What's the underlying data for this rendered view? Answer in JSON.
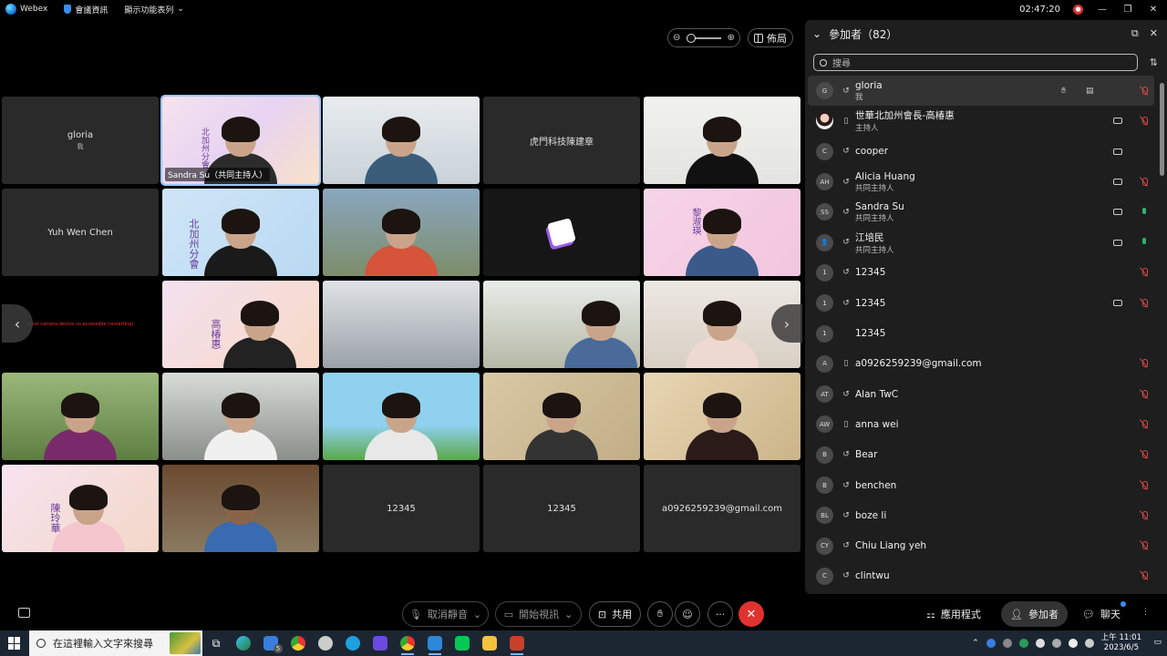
{
  "titlebar": {
    "app_name": "Webex",
    "meeting_info": "會議資訊",
    "menu": "顯示功能表列",
    "time": "02:47:20",
    "win_min": "—",
    "win_restore": "❐",
    "win_close": "✕"
  },
  "top_controls": {
    "zoom_out": "⊖",
    "zoom_in": "⊕",
    "layout_label": "佈局"
  },
  "tiles": [
    {
      "name": "gloria",
      "sub": "我"
    },
    {
      "label": "Sandra Su（共同主持人）",
      "banner": "北加州分會"
    },
    {},
    {
      "name": "虎門科技陳建章"
    },
    {},
    {
      "name": "Yuh Wen Chen"
    },
    {
      "banner": "北加州分會"
    },
    {},
    {},
    {
      "banner": "黎淑瑛"
    },
    {
      "red": "Input camera device no accessible (restarting)"
    },
    {
      "banner": "高椿惠"
    },
    {},
    {},
    {},
    {},
    {},
    {},
    {},
    {},
    {
      "banner": "陳玲華"
    },
    {},
    {
      "name": "12345"
    },
    {
      "name": "12345"
    },
    {
      "name": "a0926259239@gmail.com"
    }
  ],
  "participants_panel": {
    "title": "參加者（82）",
    "search_placeholder": "搜尋",
    "popout_icon": "⧉",
    "close_icon": "✕",
    "sort_icon": "⇅",
    "list": [
      {
        "initials": "G",
        "name": "gloria",
        "role": "我",
        "mic": "muted",
        "cam": false,
        "extra": true
      },
      {
        "initials": "",
        "name": "世華北加州會長-高椿惠",
        "role": "主持人",
        "mic": "muted",
        "cam": true
      },
      {
        "initials": "C",
        "name": "cooper",
        "role": "",
        "mic": "none",
        "cam": true
      },
      {
        "initials": "AH",
        "name": "Alicia Huang",
        "role": "共同主持人",
        "mic": "muted",
        "cam": true
      },
      {
        "initials": "SS",
        "name": "Sandra Su",
        "role": "共同主持人",
        "mic": "on",
        "cam": true
      },
      {
        "initials": "👤",
        "name": "江培民",
        "role": "共同主持人",
        "mic": "on",
        "cam": true
      },
      {
        "initials": "1",
        "name": "12345",
        "role": "",
        "mic": "muted",
        "cam": false
      },
      {
        "initials": "1",
        "name": "12345",
        "role": "",
        "mic": "muted",
        "cam": true
      },
      {
        "initials": "1",
        "name": "12345",
        "role": "",
        "mic": "none",
        "cam": false
      },
      {
        "initials": "A",
        "name": "a0926259239@gmail.com",
        "role": "",
        "mic": "muted",
        "cam": false
      },
      {
        "initials": "AT",
        "name": "Alan TwC",
        "role": "",
        "mic": "muted",
        "cam": false
      },
      {
        "initials": "AW",
        "name": "anna wei",
        "role": "",
        "mic": "muted",
        "cam": false
      },
      {
        "initials": "B",
        "name": "Bear",
        "role": "",
        "mic": "muted",
        "cam": false
      },
      {
        "initials": "B",
        "name": "benchen",
        "role": "",
        "mic": "muted",
        "cam": false
      },
      {
        "initials": "BL",
        "name": "boze li",
        "role": "",
        "mic": "muted",
        "cam": false
      },
      {
        "initials": "CY",
        "name": "Chiu Liang yeh",
        "role": "",
        "mic": "muted",
        "cam": false
      },
      {
        "initials": "C",
        "name": "clintwu",
        "role": "",
        "mic": "muted",
        "cam": false
      }
    ]
  },
  "bottom_bar": {
    "unmute": "取消靜音",
    "start_video": "開始視訊",
    "share": "共用",
    "apps": "應用程式",
    "participants": "參加者",
    "chat": "聊天",
    "more": "···"
  },
  "taskbar": {
    "search_placeholder": "在這裡輸入文字來搜尋",
    "time": "上午 11:01",
    "date": "2023/6/5",
    "badge": "5"
  },
  "colors": {
    "accent": "#3c8cf0",
    "end_call": "#e0322f",
    "muted": "#e04a4a",
    "mic_on": "#2fb36a"
  }
}
